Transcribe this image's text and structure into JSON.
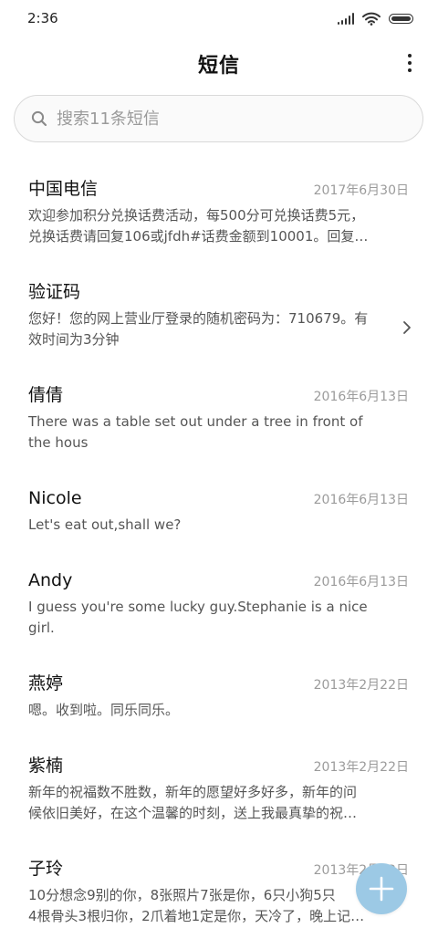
{
  "status_bar": {
    "time": "2:36",
    "icons": [
      "signal-icon",
      "wifi-icon",
      "battery-icon"
    ]
  },
  "header": {
    "title": "短信",
    "more_icon": "more-vertical-icon"
  },
  "search": {
    "placeholder": "搜索11条短信",
    "value": ""
  },
  "messages": [
    {
      "sender": "中国电信",
      "date": "2017年6月30日",
      "preview": [
        "欢迎参加积分兑换话费活动，每500分可兑换话费5元，",
        "兑换话费请回复106或jfdh#话费金额到10001。回复…"
      ]
    },
    {
      "sender": "验证码",
      "date": "",
      "preview": [
        "您好！您的网上营业厅登录的随机密码为：710679。有",
        "效时间为3分钟"
      ],
      "has_chevron": true
    },
    {
      "sender": "倩倩",
      "date": "2016年6月13日",
      "preview": [
        "There was a table set out under a tree in front of",
        "the hous"
      ]
    },
    {
      "sender": "Nicole",
      "date": "2016年6月13日",
      "preview": [
        "Let's eat out,shall we?"
      ]
    },
    {
      "sender": "Andy",
      "date": "2016年6月13日",
      "preview": [
        "I guess you're some lucky guy.Stephanie is a nice",
        "girl."
      ]
    },
    {
      "sender": "燕婷",
      "date": "2013年2月22日",
      "preview": [
        "嗯。收到啦。同乐同乐。"
      ]
    },
    {
      "sender": "紫楠",
      "date": "2013年2月22日",
      "preview": [
        "新年的祝福数不胜数，新年的愿望好多好多，新年的问",
        "候依旧美好，在这个温馨的时刻，送上我最真挚的祝…"
      ]
    },
    {
      "sender": "子玲",
      "date": "2013年2月22日",
      "preview": [
        "10分想念9别的你，8张照片7张是你，6只小狗5只",
        "4根骨头3根归你，2爪着地1定是你，天冷了，晚上记…"
      ]
    }
  ],
  "fab": {
    "icon": "plus-icon",
    "color": "#9cc9e5"
  },
  "colors": {
    "background": "#ffffff",
    "date_text": "#9b9b9b",
    "fab": "#9cc9e5"
  }
}
